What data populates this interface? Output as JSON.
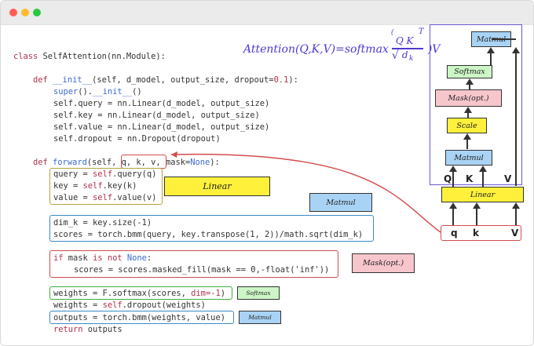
{
  "code": {
    "class_line": {
      "keyword": "class",
      "name": "SelfAttention(nn.Module):"
    },
    "init_def": {
      "keyword": "def",
      "name": "__init__",
      "params": "(self, d_model, output_size, dropout=",
      "default": "0.1",
      "end": "):"
    },
    "super_call": {
      "prefix": "super",
      "rest": "().",
      "method": "__init__",
      "end": "()"
    },
    "query_line": "self.query = nn.Linear(d_model, output_size)",
    "key_line": "self.key = nn.Linear(d_model, output_size)",
    "value_line": "self.value = nn.Linear(d_model, output_size)",
    "dropout_line": "self.dropout = nn.Dropout(dropout)",
    "forward_def": {
      "keyword": "def",
      "name": "forward",
      "open": "(self, ",
      "args": "q, k, v,",
      "mask_part": " mask=",
      "none": "None",
      "end": "):"
    },
    "q_assign": "query = ",
    "q_self": "self",
    "q_rest": ".query(q)",
    "k_assign": "key = ",
    "k_self": "self",
    "k_rest": ".key(k)",
    "v_assign": "value = ",
    "v_self": "self",
    "v_rest": ".value(v)",
    "dimk_line": "dim_k = key.size(-1)",
    "scores_line": "scores = torch.bmm(query, key.transpose(1, 2))/math.sqrt(dim_k)",
    "if_kw": "if",
    "if_mid": " mask ",
    "is_not": "is not",
    "if_none": " None",
    "if_end": ":",
    "masked_line": "scores = scores.masked_fill(mask == 0,-float('inf'))",
    "softmax_line_a": "weights = F.softmax(scores, ",
    "softmax_line_dim": "dim=-1",
    "softmax_line_end": ")",
    "dropout_apply_a": "weights = ",
    "dropout_apply_self": "self",
    "dropout_apply_b": ".dropout(weights)",
    "outputs_line": "outputs = torch.bmm(weights, value)",
    "return_kw": "return",
    "return_rest": " outputs"
  },
  "labels": {
    "linear": "Linear",
    "matmul_top": "Matmul",
    "mask": "Mask(opt.)",
    "softmax": "Softmax",
    "matmul_bottom": "Matmul"
  },
  "formula": {
    "lhs": "Attention(Q,K,V)=softmax",
    "num": "Q K",
    "sup": "T",
    "den": "d",
    "den_sub": "k",
    "rhs": ")V"
  },
  "diagram": {
    "nodes": [
      "Matmul",
      "Softmax",
      "Mask(opt.)",
      "Scale",
      "Matmul",
      "Linear"
    ],
    "side_labels": [
      "Q",
      "K",
      "V"
    ],
    "inputs": [
      "q",
      "k",
      "V"
    ]
  },
  "colors": {
    "linear_fill": "#fff13b",
    "matmul_fill": "#a9d3f5",
    "mask_fill": "#f7c6cc",
    "softmax_fill": "#cdf6c6",
    "scale_fill": "#fff13b",
    "frame": "#6b58d6",
    "formula": "#4c3ad0"
  }
}
